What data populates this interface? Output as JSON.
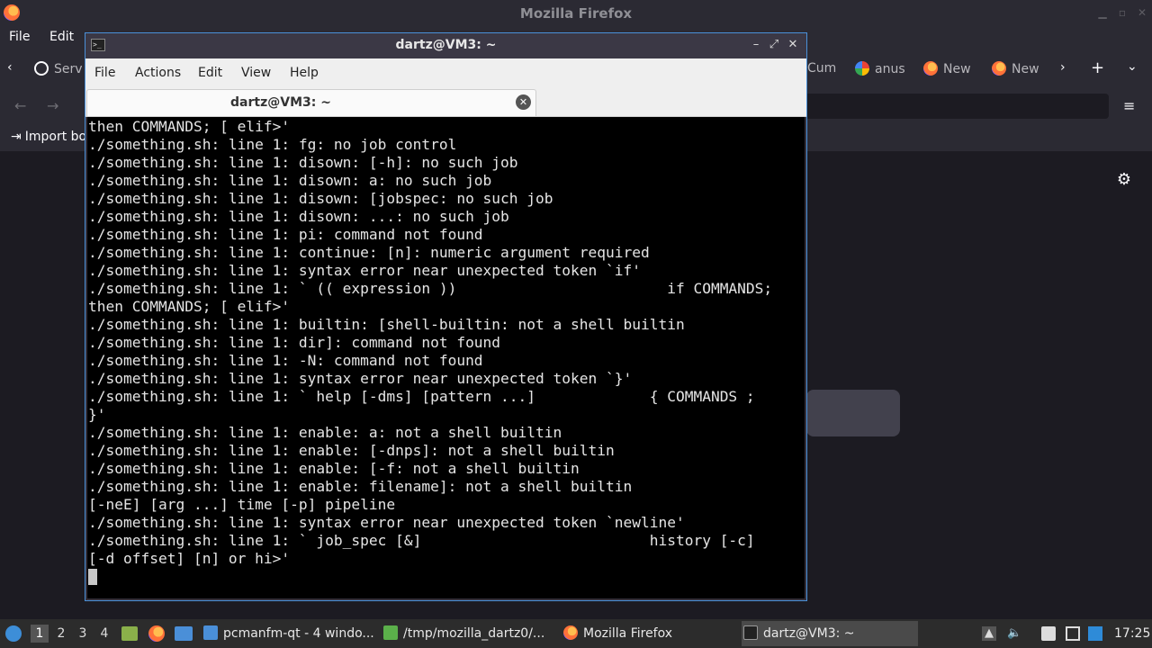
{
  "firefox": {
    "title": "Mozilla Firefox",
    "menu": [
      "File",
      "Edit"
    ],
    "tabs": [
      {
        "label": "Serv",
        "icon": "info-icon"
      },
      {
        "label": "Cum",
        "icon": "page-icon"
      },
      {
        "label": "anus",
        "icon": "google-icon"
      },
      {
        "label": "New",
        "icon": "firefox-icon"
      },
      {
        "label": "New",
        "icon": "firefox-icon"
      }
    ],
    "bookmark_label": "Import bo"
  },
  "terminal": {
    "window_title": "dartz@VM3: ~",
    "menu": [
      "File",
      "Actions",
      "Edit",
      "View",
      "Help"
    ],
    "tab_label": "dartz@VM3: ~",
    "lines": [
      "then COMMANDS; [ elif>'",
      "./something.sh: line 1: fg: no job control",
      "./something.sh: line 1: disown: [-h]: no such job",
      "./something.sh: line 1: disown: a: no such job",
      "./something.sh: line 1: disown: [jobspec: no such job",
      "./something.sh: line 1: disown: ...: no such job",
      "./something.sh: line 1: pi: command not found",
      "./something.sh: line 1: continue: [n]: numeric argument required",
      "./something.sh: line 1: syntax error near unexpected token `if'",
      "./something.sh: line 1: ` (( expression ))                        if COMMANDS;",
      "then COMMANDS; [ elif>'",
      "./something.sh: line 1: builtin: [shell-builtin: not a shell builtin",
      "./something.sh: line 1: dir]: command not found",
      "./something.sh: line 1: -N: command not found",
      "./something.sh: line 1: syntax error near unexpected token `}'",
      "./something.sh: line 1: ` help [-dms] [pattern ...]             { COMMANDS ;",
      "}'",
      "./something.sh: line 1: enable: a: not a shell builtin",
      "./something.sh: line 1: enable: [-dnps]: not a shell builtin",
      "./something.sh: line 1: enable: [-f: not a shell builtin",
      "./something.sh: line 1: enable: filename]: not a shell builtin",
      "[-neE] [arg ...] time [-p] pipeline",
      "./something.sh: line 1: syntax error near unexpected token `newline'",
      "./something.sh: line 1: ` job_spec [&]                          history [-c]",
      "[-d offset] [n] or hi>'"
    ]
  },
  "taskbar": {
    "workspaces": [
      "1",
      "2",
      "3",
      "4"
    ],
    "tasks": [
      {
        "label": "pcmanfm-qt - 4 windo...",
        "icon": "folder-icon"
      },
      {
        "label": "/tmp/mozilla_dartz0/...",
        "icon": "file-icon"
      },
      {
        "label": "Mozilla Firefox",
        "icon": "firefox-icon"
      },
      {
        "label": "dartz@VM3: ~",
        "icon": "terminal-icon"
      }
    ],
    "clock": "17:25"
  },
  "colors": {
    "terminal_bg": "#000000",
    "terminal_fg": "#e5e5e5",
    "window_border": "#4a90d9",
    "firefox_chrome": "#2b2a33"
  }
}
